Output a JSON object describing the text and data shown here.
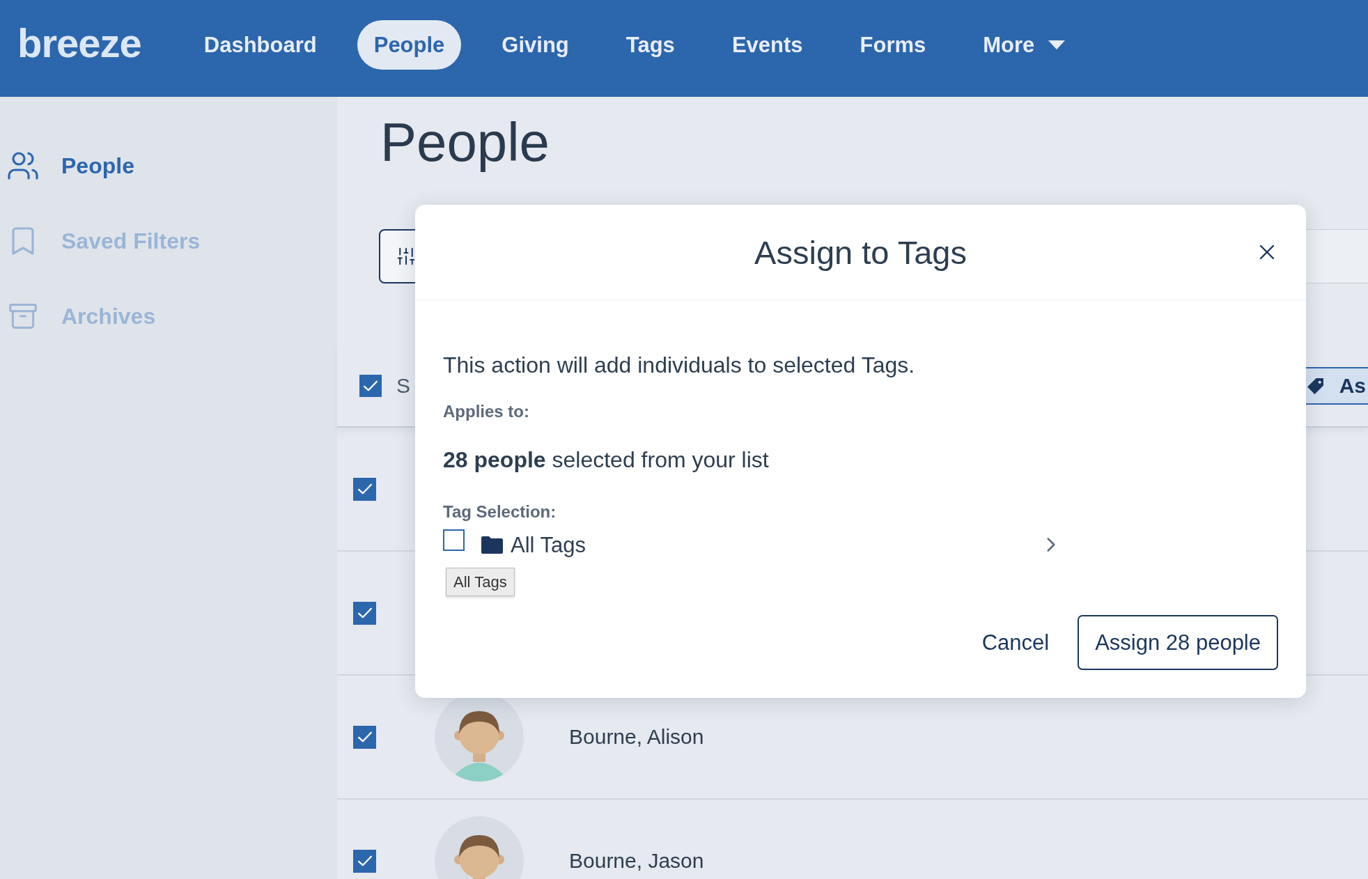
{
  "nav": {
    "logo": "breeze",
    "items": [
      {
        "label": "Dashboard",
        "selected": false,
        "kind": "link"
      },
      {
        "label": "People",
        "selected": true,
        "kind": "link"
      },
      {
        "label": "Giving",
        "selected": false,
        "kind": "link"
      },
      {
        "label": "Tags",
        "selected": false,
        "kind": "link"
      },
      {
        "label": "Events",
        "selected": false,
        "kind": "link"
      },
      {
        "label": "Forms",
        "selected": false,
        "kind": "link"
      },
      {
        "label": "More",
        "selected": false,
        "kind": "dropdown"
      }
    ]
  },
  "sidebar": {
    "items": [
      {
        "label": "People",
        "selected": true,
        "kind": "people"
      },
      {
        "label": "Saved Filters",
        "selected": false,
        "kind": "bookmark"
      },
      {
        "label": "Archives",
        "selected": false,
        "kind": "archive"
      }
    ]
  },
  "page": {
    "title": "People"
  },
  "list_header": {
    "select_all": {
      "label": "S",
      "checked": true
    },
    "action_button": {
      "label": "As"
    }
  },
  "rows": [
    {
      "checked": true
    },
    {
      "checked": true
    },
    {
      "checked": true,
      "name": "Bourne, Alison"
    },
    {
      "checked": true,
      "name": "Bourne, Jason"
    }
  ],
  "dialog": {
    "title": "Assign to Tags",
    "intro": "This action will add individuals to selected Tags.",
    "applies_label": "Applies to:",
    "applies_text": "**28 people** selected from your list",
    "tag_label": "Tag Selection:",
    "tags": [
      {
        "label": "All Tags",
        "checked": false,
        "expanded": false
      }
    ],
    "tooltip": "All Tags",
    "buttons": [
      {
        "label": "Cancel",
        "kind": "text"
      },
      {
        "label": "Assign 28 people",
        "kind": "outline"
      }
    ]
  }
}
